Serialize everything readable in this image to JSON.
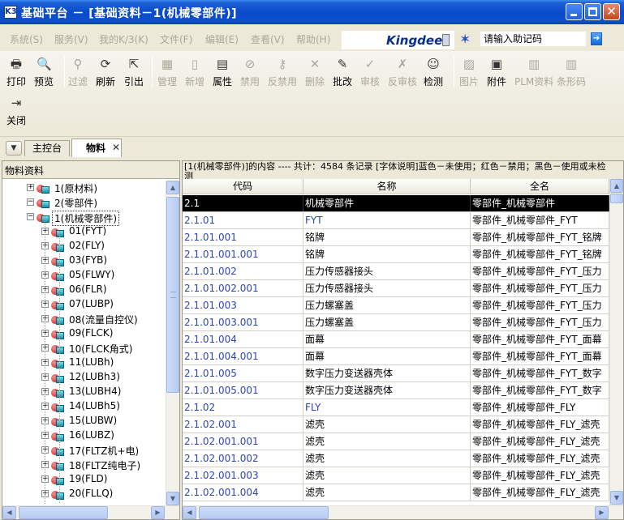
{
  "window": {
    "title": "基础平台 － [基础资料－1(机械零部件)]",
    "app_icon": "K3"
  },
  "menubar": {
    "items": [
      "系统(S)",
      "服务(V)",
      "我的K/3(K)",
      "文件(F)",
      "编辑(E)",
      "查看(V)",
      "帮助(H)"
    ]
  },
  "brand": {
    "logo": "Kingdee"
  },
  "help_code": {
    "value": "请输入助记码",
    "go": "➔"
  },
  "toolbar": {
    "buttons": [
      {
        "label": "打印",
        "icon": "printer-icon",
        "glyph": "🖶"
      },
      {
        "label": "预览",
        "icon": "preview-icon",
        "glyph": "🔍"
      },
      {
        "label": "过滤",
        "icon": "filter-icon",
        "glyph": "⚲"
      },
      {
        "label": "刷新",
        "icon": "refresh-icon",
        "glyph": "⟳"
      },
      {
        "label": "引出",
        "icon": "export-icon",
        "glyph": "⇱"
      },
      {
        "label": "管理",
        "icon": "manage-icon",
        "glyph": "▦"
      },
      {
        "label": "新增",
        "icon": "new-icon",
        "glyph": "▯"
      },
      {
        "label": "属性",
        "icon": "properties-icon",
        "glyph": "▤"
      },
      {
        "label": "禁用",
        "icon": "disable-icon",
        "glyph": "⊘"
      },
      {
        "label": "反禁用",
        "icon": "enable-icon",
        "glyph": "⚷"
      },
      {
        "label": "删除",
        "icon": "delete-icon",
        "glyph": "✕"
      },
      {
        "label": "批改",
        "icon": "batch-edit-icon",
        "glyph": "✎"
      },
      {
        "label": "审核",
        "icon": "audit-icon",
        "glyph": "✓"
      },
      {
        "label": "反审核",
        "icon": "unaudit-icon",
        "glyph": "✗"
      },
      {
        "label": "检测",
        "icon": "check-icon",
        "glyph": "☺"
      },
      {
        "label": "图片",
        "icon": "image-icon",
        "glyph": "▨"
      },
      {
        "label": "附件",
        "icon": "attachment-icon",
        "glyph": "▣"
      },
      {
        "label": "PLM资料",
        "icon": "plm-icon",
        "glyph": "▥"
      },
      {
        "label": "条形码",
        "icon": "barcode-icon",
        "glyph": "▥"
      }
    ],
    "close": {
      "label": "关闭",
      "icon": "close-doc-icon",
      "glyph": "⇥"
    }
  },
  "tabs": {
    "dropdown": "▼",
    "main": "主控台",
    "active": "物料",
    "close": "✕"
  },
  "left_panel": {
    "header": "物料资料",
    "tree": [
      {
        "label": "1(原材料)",
        "level": 0,
        "expanded": false
      },
      {
        "label": "2(零部件)",
        "level": 0,
        "expanded": true
      },
      {
        "label": "1(机械零部件)",
        "level": 1,
        "expanded": true,
        "selected": true
      },
      {
        "label": "01(FYT)",
        "level": 2
      },
      {
        "label": "02(FLY)",
        "level": 2
      },
      {
        "label": "03(FYB)",
        "level": 2
      },
      {
        "label": "05(FLWY)",
        "level": 2
      },
      {
        "label": "06(FLR)",
        "level": 2
      },
      {
        "label": "07(LUBP)",
        "level": 2
      },
      {
        "label": "08(流量自控仪)",
        "level": 2
      },
      {
        "label": "09(FLCK)",
        "level": 2
      },
      {
        "label": "10(FLCK角式)",
        "level": 2
      },
      {
        "label": "11(LUBh)",
        "level": 2
      },
      {
        "label": "12(LUBh3)",
        "level": 2
      },
      {
        "label": "13(LUBH4)",
        "level": 2
      },
      {
        "label": "14(LUBh5)",
        "level": 2
      },
      {
        "label": "15(LUBW)",
        "level": 2
      },
      {
        "label": "16(LUBZ)",
        "level": 2
      },
      {
        "label": "17(FLTZ机+电)",
        "level": 2
      },
      {
        "label": "18(FLTZ纯电子)",
        "level": 2
      },
      {
        "label": "19(FLD)",
        "level": 2
      },
      {
        "label": "20(FLLQ)",
        "level": 2
      }
    ]
  },
  "right_panel": {
    "info": "[1(机械零部件)]的内容 ---- 共计：4584 条记录 [字体说明]蓝色－未使用；红色－禁用；黑色－使用或未检测",
    "columns": [
      "代码",
      "名称",
      "全名"
    ],
    "rows": [
      {
        "code": "2.1",
        "name": "机械零部件",
        "full": "零部件_机械零部件",
        "selected": true
      },
      {
        "code": "2.1.01",
        "name": "FYT",
        "full": "零部件_机械零部件_FYT",
        "blue": true
      },
      {
        "code": "2.1.01.001",
        "name": "铭牌",
        "full": "零部件_机械零部件_FYT_铭牌"
      },
      {
        "code": "2.1.01.001.001",
        "name": "铭牌",
        "full": "零部件_机械零部件_FYT_铭牌"
      },
      {
        "code": "2.1.01.002",
        "name": "压力传感器接头",
        "full": "零部件_机械零部件_FYT_压力"
      },
      {
        "code": "2.1.01.002.001",
        "name": "压力传感器接头",
        "full": "零部件_机械零部件_FYT_压力"
      },
      {
        "code": "2.1.01.003",
        "name": "压力螺塞盖",
        "full": "零部件_机械零部件_FYT_压力"
      },
      {
        "code": "2.1.01.003.001",
        "name": "压力螺塞盖",
        "full": "零部件_机械零部件_FYT_压力"
      },
      {
        "code": "2.1.01.004",
        "name": "面幕",
        "full": "零部件_机械零部件_FYT_面幕"
      },
      {
        "code": "2.1.01.004.001",
        "name": "面幕",
        "full": "零部件_机械零部件_FYT_面幕"
      },
      {
        "code": "2.1.01.005",
        "name": "数字压力变送器壳体",
        "full": "零部件_机械零部件_FYT_数字"
      },
      {
        "code": "2.1.01.005.001",
        "name": "数字压力变送器壳体",
        "full": "零部件_机械零部件_FYT_数字"
      },
      {
        "code": "2.1.02",
        "name": "FLY",
        "full": "零部件_机械零部件_FLY",
        "blue": true
      },
      {
        "code": "2.1.02.001",
        "name": "滤壳",
        "full": "零部件_机械零部件_FLY_滤壳"
      },
      {
        "code": "2.1.02.001.001",
        "name": "滤壳",
        "full": "零部件_机械零部件_FLY_滤壳"
      },
      {
        "code": "2.1.02.001.002",
        "name": "滤壳",
        "full": "零部件_机械零部件_FLY_滤壳"
      },
      {
        "code": "2.1.02.001.003",
        "name": "滤壳",
        "full": "零部件_机械零部件_FLY_滤壳"
      },
      {
        "code": "2.1.02.001.004",
        "name": "滤壳",
        "full": "零部件_机械零部件_FLY_滤壳"
      }
    ]
  },
  "colors": {
    "titlebar": "#0a4bc9",
    "code_blue": "#2d45b5",
    "selected_row": "#000000"
  }
}
